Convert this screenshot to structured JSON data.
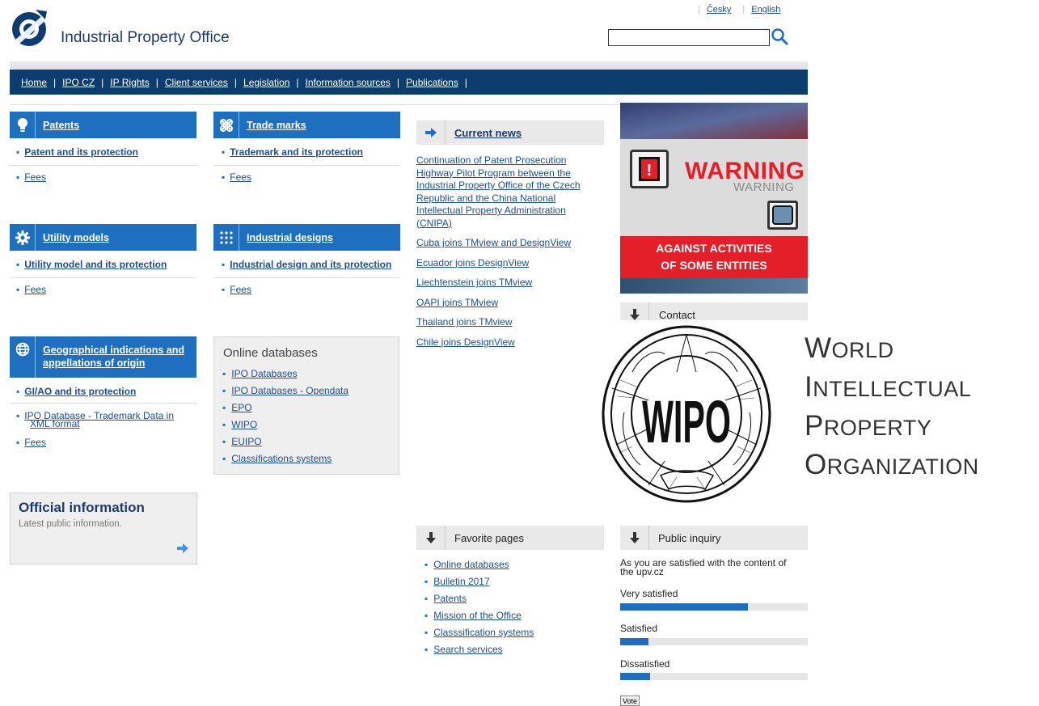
{
  "header": {
    "site_title": "Industrial Property Office",
    "lang_cz": "Česky",
    "lang_en": "English",
    "search_value": ""
  },
  "nav": {
    "items": [
      "Home",
      "IPO CZ",
      "IP Rights",
      "Client services",
      "Legislation",
      "Information sources",
      "Publications"
    ]
  },
  "categories": {
    "patents": {
      "title": "Patents",
      "link1": "Patent and its protection",
      "link2": "Fees",
      "icon": "lightbulb-icon"
    },
    "trademarks": {
      "title": "Trade marks",
      "link1": "Trademark and its protection",
      "link2": "Fees",
      "icon": "trademark-knot-icon"
    },
    "utility": {
      "title": "Utility models",
      "link1": "Utility model and its protection",
      "link2": "Fees",
      "icon": "gear-icon"
    },
    "designs": {
      "title": "Industrial designs",
      "link1": "Industrial design and its protection",
      "link2": "Fees",
      "icon": "dot-grid-icon"
    },
    "geo": {
      "title_line1": "Geographical indications and",
      "title_line2": "appellations of origin",
      "link1": "GI/AO and its protection",
      "link2_line1": "IPO Database - Trademark Data in",
      "link2_line2": "XML format",
      "link3": "Fees",
      "icon": "globe-icon"
    }
  },
  "online_databases": {
    "title": "Online databases",
    "items": [
      "IPO Databases",
      "IPO Databases - Opendata",
      "EPO",
      "WIPO",
      "EUIPO",
      "Classifications systems"
    ]
  },
  "official": {
    "title": "Official information",
    "subtitle": "Latest public information."
  },
  "news": {
    "title": "Current news",
    "items": [
      "Continuation of Patent Prosecution Highway Pilot Program between the Industrial Property Office of the Czech Republic and the China National Intellectual Property Administration (CNIPA)",
      "Cuba joins TMview and DesignView",
      "Ecuador joins DesignView",
      "Liechtenstein joins TMview",
      "OAPI joins TMview",
      "Thailand joins TMview",
      "Chile joins DesignView"
    ]
  },
  "banner": {
    "warning_big": "WARNING",
    "warning_small": "WARNING",
    "line1": "AGAINST ACTIVITIES",
    "line2": "OF SOME ENTITIES"
  },
  "contact": {
    "title": "Contact"
  },
  "wipo": {
    "emblem_text": "WIPO",
    "line1_cap": "W",
    "line1_rest": "ORLD",
    "line2_cap": "I",
    "line2_rest": "NTELLECTUAL",
    "line3_cap": "P",
    "line3_rest": "ROPERTY",
    "line4_cap": "O",
    "line4_rest": "RGANIZATION"
  },
  "favorites": {
    "title": "Favorite pages",
    "items": [
      "Online databases",
      "Bulletin 2017",
      "Patents",
      "Mission of the Office",
      "Classsification systems",
      "Search services"
    ]
  },
  "inquiry": {
    "title": "Public inquiry",
    "question_line1": "As you are satisfied with the content of",
    "question_line2": "the upv.cz",
    "options": [
      {
        "label": "Very satisfied",
        "share": 0.68
      },
      {
        "label": "Satisfied",
        "share": 0.15
      },
      {
        "label": "Dissatisfied",
        "share": 0.16
      }
    ],
    "vote_label": "Vote"
  },
  "colors": {
    "nav": "#0d3d6e",
    "accent": "#1f6fc1",
    "warning_red": "#e3202a"
  }
}
